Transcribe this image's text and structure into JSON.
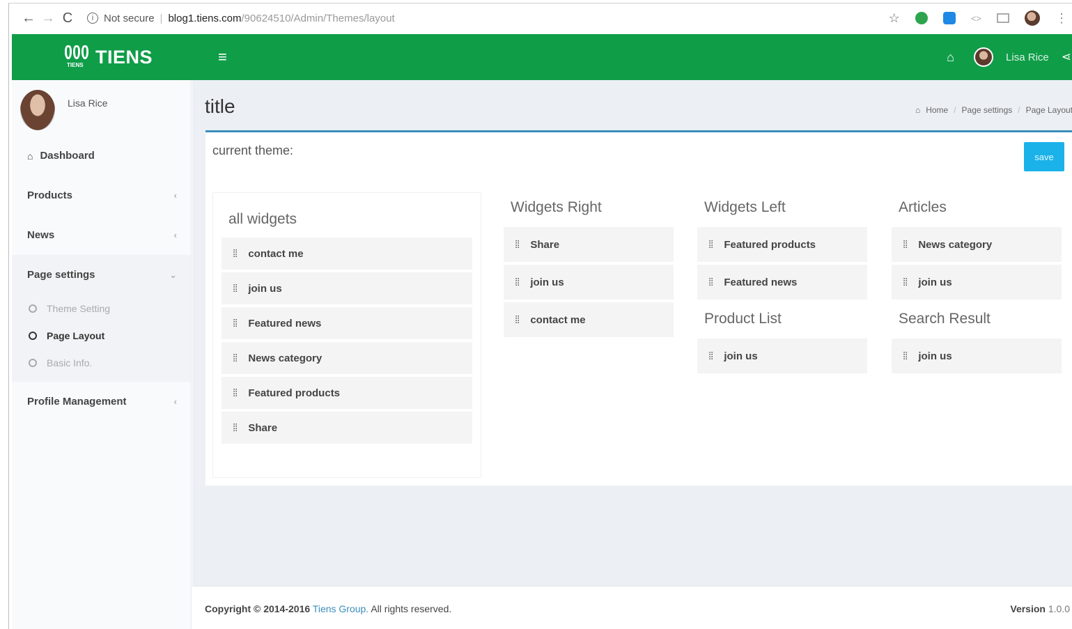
{
  "browser": {
    "security_label": "Not secure",
    "url_host": "blog1.tiens.com",
    "url_path": "/90624510/Admin/Themes/layout"
  },
  "header": {
    "logo_text": "TIENS",
    "logo_small": "TIENS",
    "user_name": "Lisa Rice",
    "brand_color": "#0f9d48"
  },
  "sidebar": {
    "user_name": "Lisa Rice",
    "items": [
      {
        "label": "Dashboard"
      },
      {
        "label": "Products"
      },
      {
        "label": "News"
      },
      {
        "label": "Page settings"
      },
      {
        "label": "Profile Management"
      }
    ],
    "sub_items": [
      {
        "label": "Theme Setting"
      },
      {
        "label": "Page Layout"
      },
      {
        "label": "Basic Info."
      }
    ]
  },
  "page": {
    "title": "title",
    "breadcrumb": [
      "Home",
      "Page settings",
      "Page Layout"
    ],
    "current_theme_label": "current theme:",
    "save_label": "save"
  },
  "widgets": {
    "all_title": "all widgets",
    "all": [
      "contact me",
      "join us",
      "Featured news",
      "News category",
      "Featured products",
      "Share"
    ],
    "right_title": "Widgets Right",
    "right": [
      "Share",
      "join us",
      "contact me"
    ],
    "left_title": "Widgets Left",
    "left": [
      "Featured products",
      "Featured news"
    ],
    "articles_title": "Articles",
    "articles": [
      "News category",
      "join us"
    ],
    "product_list_title": "Product List",
    "product_list": [
      "join us"
    ],
    "search_result_title": "Search Result",
    "search_result": [
      "join us"
    ]
  },
  "footer": {
    "copyright_prefix": "Copyright © 2014-2016",
    "company": "Tiens Group.",
    "rights": "All rights reserved.",
    "version_label": "Version",
    "version_value": "1.0.0"
  }
}
